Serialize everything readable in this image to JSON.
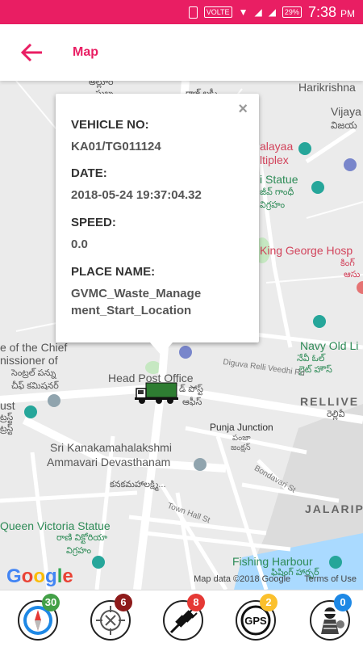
{
  "status_bar": {
    "time": "7:38",
    "ampm": "PM",
    "network": "VOLTE",
    "battery": "29%"
  },
  "app_bar": {
    "title": "Map"
  },
  "popup": {
    "close": "×",
    "vehicle_label": "VEHICLE NO:",
    "vehicle_value": "KA01/TG011124",
    "date_label": "DATE:",
    "date_value": "2018-05-24 19:37:04.32",
    "speed_label": "SPEED:",
    "speed_value": "0.0",
    "place_label": "PLACE NAME:",
    "place_value_1": "GVMC_Waste_Manage",
    "place_value_2": "ment_Start_Location"
  },
  "map": {
    "labels": {
      "harikrishna": "Harikrishna",
      "vijaya": "Vijaya",
      "vijaya_te": "విజయ",
      "alayaa": "alayaa",
      "ltiplex": "ltiplex",
      "statue": "i Statue",
      "statue_te1": "జీవ్ గాంధీ",
      "statue_te2": "విగ్రహం",
      "king_george": "King George Hosp",
      "king_te": "కింగ్",
      "king_te2": "ఆసు",
      "navy": "Navy Old Li",
      "navy_te1": "నేవీ ఓల్",
      "navy_te2": "లైట్ హౌస్",
      "relli": "RELLIVE",
      "relli_te": "రెల్లివీ",
      "chief1": "e of the Chief",
      "chief2": "nissioner of",
      "chief_te1": "సెంట్రల్ పన్ను",
      "chief_te2": "చీఫ్ కమిషనర్",
      "trust": "ust",
      "trust_te1": "ట్రస్ట్",
      "trust_te2": "ట్రస్ట్",
      "head_post": "Head Post Office",
      "head_post_te1": "డ్ పోస్ట్",
      "head_post_te2": "ఆఫీస్",
      "digu": "Diguva Relli Veedhi Rd",
      "punja": "Punja Junction",
      "punja_te1": "పంజా",
      "punja_te2": "జంక్షన్",
      "kanaka1": "Sri Kanakamahalakshmi",
      "kanaka2": "Ammavari Devasthanam",
      "kanaka_te": "కనకమహాలక్ష్మి...",
      "bondavari": "Bondavari St",
      "town_hall": "Town Hall St",
      "jalari": "JALARIPE",
      "queen1": "Queen Victoria Statue",
      "queen_te1": "రాణి విక్టోరియా",
      "queen_te2": "విగ్రహం",
      "fishing": "Fishing Harbour",
      "fishing_te": "ఫిషింగ్ హార్బర్",
      "top_te1": "అల్లూరి",
      "top_te2": "సుబ్బ",
      "top_te3": "రాజ్ లక్ష్మీ"
    },
    "google_logo": "Google",
    "attribution": "Map data ©2018 Google",
    "terms": "Terms of Use"
  },
  "bottom_nav": [
    {
      "name": "compass",
      "badge": "30",
      "color": "#43a047"
    },
    {
      "name": "gps-off",
      "badge": "6",
      "color": "#8e1b1b"
    },
    {
      "name": "unplugged",
      "badge": "8",
      "color": "#e53935"
    },
    {
      "name": "gps",
      "badge": "2",
      "color": "#fbc02d"
    },
    {
      "name": "thief",
      "badge": "0",
      "color": "#1e88e5"
    }
  ],
  "colors": {
    "accent": "#e91e63",
    "truck_green": "#2e7d32"
  }
}
